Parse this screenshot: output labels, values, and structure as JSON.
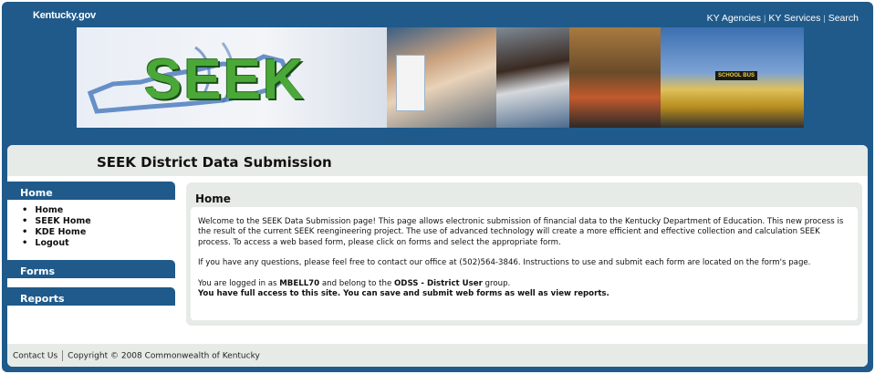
{
  "header": {
    "brand": "Kentucky.gov",
    "links": [
      "KY Agencies",
      "KY Services",
      "Search"
    ]
  },
  "banner": {
    "logo_text": "SEEK",
    "bus_text": "SCHOOL BUS"
  },
  "page": {
    "title": "SEEK District Data Submission"
  },
  "sidebar": {
    "home_heading": "Home",
    "home_items": [
      "Home",
      "SEEK Home",
      "KDE Home",
      "Logout"
    ],
    "forms_heading": "Forms",
    "reports_heading": "Reports"
  },
  "main": {
    "heading": "Home",
    "intro": "Welcome to the SEEK Data Submission page! This page allows electronic submission of financial data to the Kentucky Department of Education. This new process is the result of the current SEEK reengineering project. The use of advanced technology will create a more efficient and effective collection and calculation SEEK process. To access a web based form, please click on forms and select the appropriate form.",
    "contact": "If you have any questions, please feel free to contact our office at (502)564-3846. Instructions to use and submit each form are located on the form's page.",
    "login_prefix": "You are logged in as ",
    "username": "MBELL70",
    "login_middle": " and belong to the ",
    "group": "ODSS - District User",
    "login_suffix": " group.",
    "access": "You have full access to this site. You can save and submit web forms as well as view reports."
  },
  "footer": {
    "contact": "Contact Us",
    "copyright": "Copyright © 2008 Commonwealth of Kentucky"
  },
  "colors": {
    "frame_blue": "#1f5a8a",
    "panel_gray": "#e7ebe7",
    "logo_green": "#4aa838"
  }
}
